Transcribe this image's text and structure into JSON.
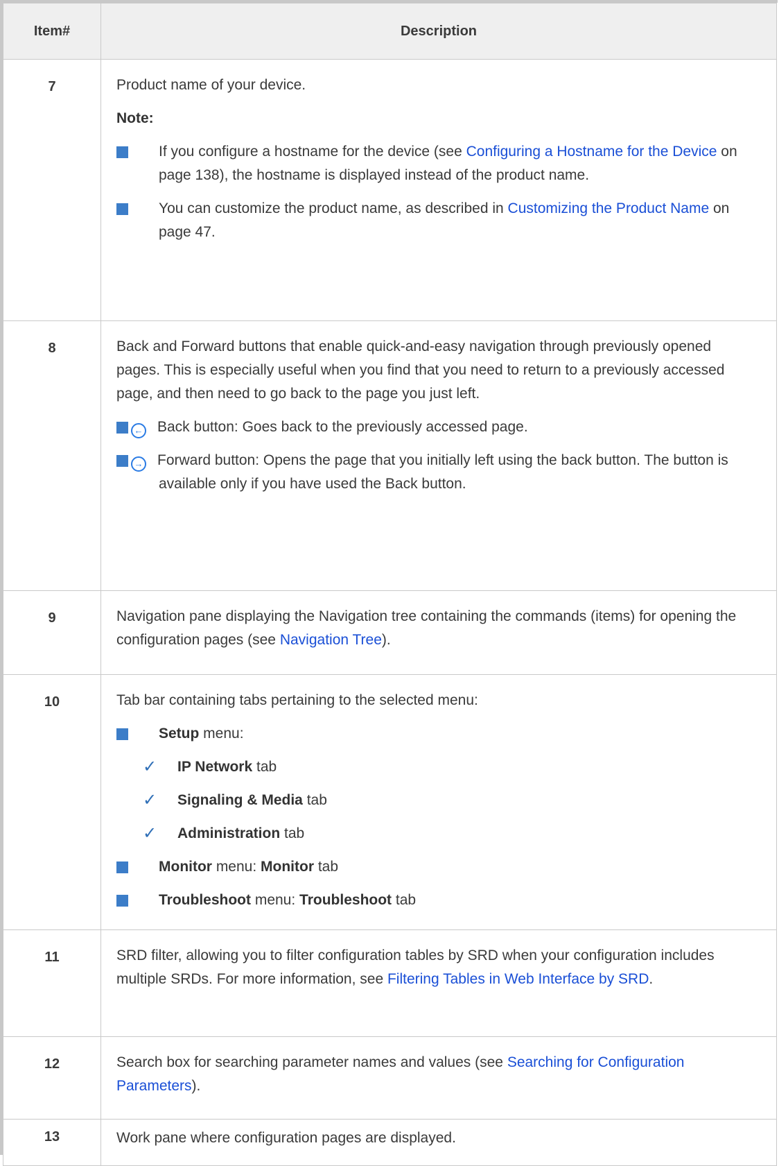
{
  "headers": {
    "item": "Item#",
    "description": "Description"
  },
  "rows": {
    "r7": {
      "num": "7",
      "text": "Product name of your device.",
      "note_label": "Note:",
      "b1_pre": "If you configure a hostname for the device (see ",
      "b1_link": "Configuring a Hostname for the Device",
      "b1_post": " on page 138), the hostname is displayed instead of the product name.",
      "b2_pre": "You can customize the product name, as described in ",
      "b2_link": "Customizing the Product Name",
      "b2_post": " on page 47."
    },
    "r8": {
      "num": "8",
      "text": "Back and Forward buttons that enable quick-and-easy navigation through previously opened pages. This is especially useful when you find that you need to return to a previously accessed page, and then need to go back to the page you just left.",
      "back": "Back button: Goes back to the previously accessed page.",
      "forward": "Forward button: Opens the page that you initially left using the back button. The button is available only if you have used the Back button.",
      "back_icon": "back-arrow-circle-icon",
      "forward_icon": "forward-arrow-circle-icon"
    },
    "r9": {
      "num": "9",
      "pre": "Navigation pane displaying the Navigation tree containing the commands (items) for opening the configuration pages (see ",
      "link": "Navigation Tree",
      "post": ")."
    },
    "r10": {
      "num": "10",
      "text": "Tab bar containing tabs pertaining to the selected menu:",
      "setup_bold": "Setup",
      "setup_rest": " menu:",
      "ipnet_bold": "IP Network",
      "sig_bold": "Signaling & Media",
      "admin_bold": "Administration",
      "tab_word": " tab",
      "monitor_bold1": "Monitor",
      "monitor_mid": " menu: ",
      "monitor_bold2": "Monitor",
      "troub_bold1": "Troubleshoot",
      "troub_mid": " menu: ",
      "troub_bold2": "Troubleshoot"
    },
    "r11": {
      "num": "11",
      "pre": "SRD filter, allowing you to filter configuration tables by SRD when your configuration includes multiple SRDs. For more information, see ",
      "link": "Filtering Tables in Web Interface by SRD",
      "post": "."
    },
    "r12": {
      "num": "12",
      "pre": "Search box for searching parameter names and values (see ",
      "link": "Searching for Configuration Parameters",
      "post": ")."
    },
    "r13": {
      "num": "13",
      "text": "Work pane where configuration pages are displayed."
    }
  },
  "colors": {
    "bullet": "#3c7dc8",
    "link": "#1a4fd6",
    "header_bg": "#efefef"
  }
}
